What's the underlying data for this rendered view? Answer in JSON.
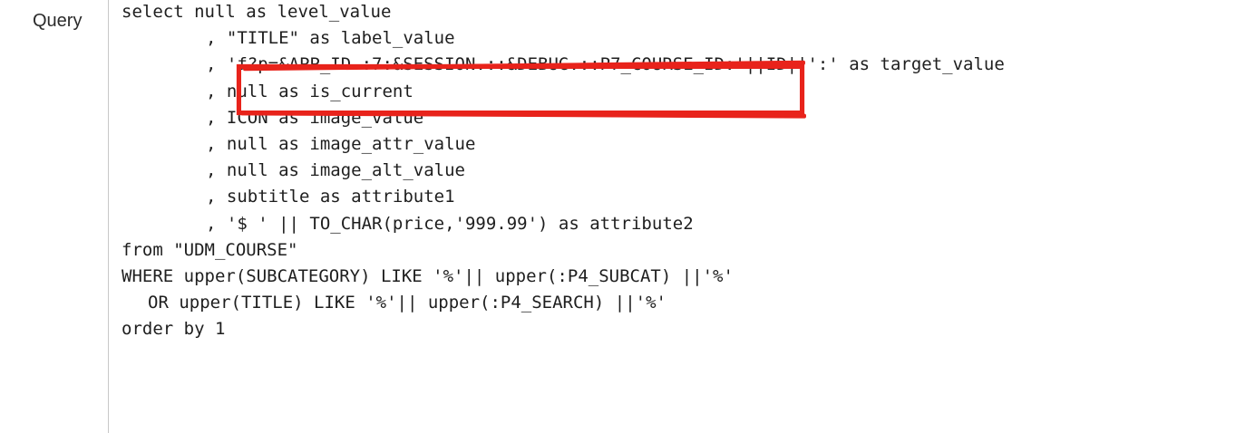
{
  "field": {
    "label": "Query"
  },
  "editor": {
    "lines": [
      "select null as level_value",
      ", \"TITLE\" as label_value",
      ", 'f?p=&APP_ID.:7:&SESSION.::&DEBUG.::P7_COURSE_ID:'||ID||':' as target_value",
      ", null as is_current",
      ", ICON as image_value",
      ", null as image_attr_value",
      ", null as image_alt_value",
      ", subtitle as attribute1",
      ", '$ ' || TO_CHAR(price,'999.99') as attribute2",
      "from \"UDM_COURSE\"",
      "WHERE upper(SUBCATEGORY) LIKE '%'|| upper(:P4_SUBCAT) ||'%'",
      "OR upper(TITLE) LIKE '%'|| upper(:P4_SEARCH) ||'%'",
      "order by 1"
    ]
  },
  "annotation": {
    "color": "#e8231b"
  }
}
